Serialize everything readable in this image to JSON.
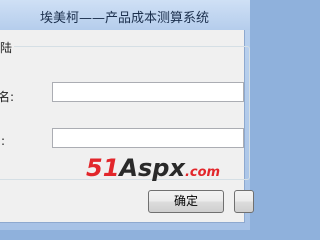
{
  "window": {
    "title": "埃美柯——产品成本测算系统"
  },
  "login_group": {
    "legend": "陆",
    "username_label": "名:",
    "username_value": "",
    "password_label": ":",
    "password_value": ""
  },
  "buttons": {
    "confirm_label": "确定",
    "second_label": ""
  },
  "watermark": {
    "part1": "51",
    "part2": "Aspx",
    "part3": ".com"
  },
  "colors": {
    "titlebar": "#b5cdec",
    "client_bg": "#f0f0f0",
    "watermark_red": "#e2262b"
  }
}
